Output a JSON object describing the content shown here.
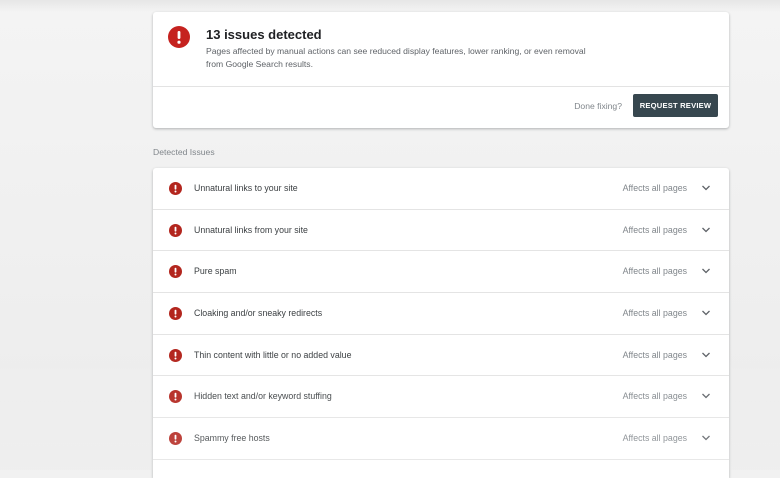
{
  "summary": {
    "icon": "alert-icon",
    "title": "13 issues detected",
    "description": "Pages affected by manual actions can see reduced display features, lower ranking, or even removal from Google Search results.",
    "done_fixing_text": "Done fixing?",
    "request_review_label": "REQUEST REVIEW"
  },
  "section": {
    "heading": "Detected Issues"
  },
  "colors": {
    "alert_red": "#c5221f",
    "button_dark": "#37474f"
  },
  "issues": [
    {
      "label": "Unnatural links to your site",
      "scope": "Affects all pages"
    },
    {
      "label": "Unnatural links from your site",
      "scope": "Affects all pages"
    },
    {
      "label": "Pure spam",
      "scope": "Affects all pages"
    },
    {
      "label": "Cloaking and/or sneaky redirects",
      "scope": "Affects all pages"
    },
    {
      "label": "Thin content with little or no added value",
      "scope": "Affects all pages"
    },
    {
      "label": "Hidden text and/or keyword stuffing",
      "scope": "Affects all pages"
    },
    {
      "label": "Spammy free hosts",
      "scope": "Affects all pages"
    }
  ]
}
